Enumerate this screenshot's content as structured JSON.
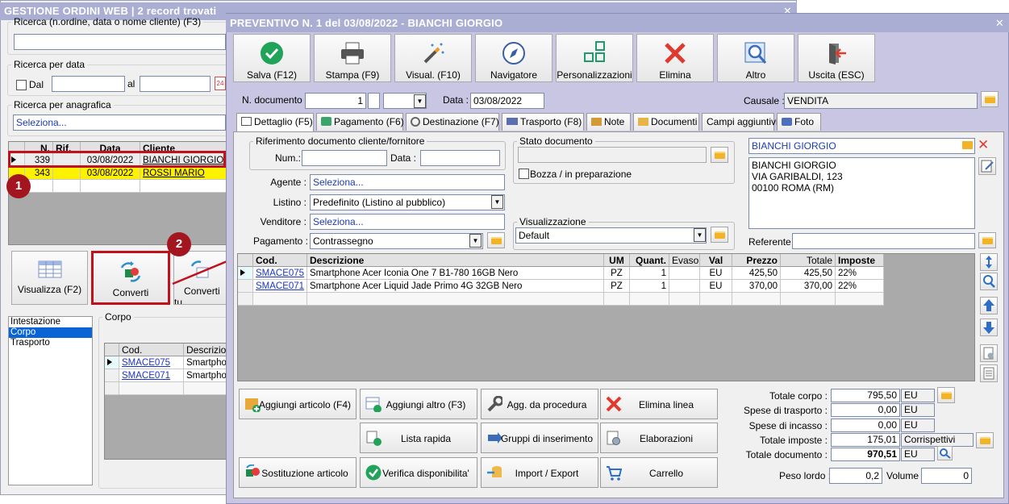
{
  "back": {
    "title": "GESTIONE ORDINI WEB | 2 record trovati",
    "search_legend": "Ricerca (n.ordine, data o nome cliente) (F3)",
    "date_legend": "Ricerca per data",
    "date_from_label": "Dal",
    "date_to_label": "al",
    "anag_legend": "Ricerca per anagrafica",
    "anag_value": "Seleziona...",
    "grid_headers": [
      "N.",
      "Rif.",
      "Data",
      "Cliente"
    ],
    "rows": [
      {
        "n": "339",
        "rif": "",
        "data": "03/08/2022",
        "cliente": "BIANCHI GIORGIO"
      },
      {
        "n": "343",
        "rif": "",
        "data": "03/08/2022",
        "cliente": "ROSSI MARIO"
      }
    ],
    "btn_visualizza": "Visualizza (F2)",
    "btn_converti": "Converti",
    "btn_converti_tutti": "Converti tu",
    "list_items": [
      "Intestazione",
      "Corpo",
      "Trasporto"
    ],
    "corpo_legend": "Corpo",
    "corpo_headers": [
      "Cod.",
      "Descrizion"
    ],
    "corpo_rows": [
      {
        "cod": "SMACE075",
        "desc": "Smartphon"
      },
      {
        "cod": "SMACE071",
        "desc": "Smartphon"
      }
    ],
    "step1": "1",
    "step2": "2"
  },
  "win": {
    "title": "PREVENTIVO N. 1 del 03/08/2022 - BIANCHI GIORGIO",
    "toolbar": [
      "Salva (F12)",
      "Stampa (F9)",
      "Visual. (F10)",
      "Navigatore",
      "Personalizzazioni",
      "Elimina",
      "Altro",
      "Uscita (ESC)"
    ],
    "ndoc_label": "N. documento :",
    "ndoc_value": "1",
    "data_label": "Data :",
    "data_value": "03/08/2022",
    "causale_label": "Causale :",
    "causale_value": "VENDITA",
    "tabs": [
      "Dettaglio (F5)",
      "Pagamento (F6)",
      "Destinazione (F7)",
      "Trasporto (F8)",
      "Note",
      "Documenti",
      "Campi aggiuntivi",
      "Foto"
    ],
    "rif_legend": "Riferimento documento cliente/fornitore",
    "num_label": "Num.:",
    "rdata_label": "Data :",
    "stato_legend": "Stato documento",
    "bozza_label": "Bozza / in preparazione",
    "agente_label": "Agente :",
    "agente_value": "Seleziona...",
    "listino_label": "Listino :",
    "listino_value": "Predefinito (Listino al pubblico)",
    "venditore_label": "Venditore :",
    "venditore_value": "Seleziona...",
    "pagamento_label": "Pagamento :",
    "pagamento_value": "Contrassegno",
    "visual_legend": "Visualizzazione",
    "visual_value": "Default",
    "cliente_name": "BIANCHI GIORGIO",
    "addr": [
      "BIANCHI GIORGIO",
      "VIA GARIBALDI, 123",
      "00100 ROMA (RM)"
    ],
    "referente_label": "Referente",
    "grid_headers": [
      "Cod.",
      "Descrizione",
      "UM",
      "Quant.",
      "Evaso",
      "Val",
      "Prezzo",
      "Totale",
      "Imposte"
    ],
    "rows": [
      {
        "cod": "SMACE075",
        "desc": "Smartphone Acer Iconia One 7 B1-780 16GB Nero",
        "um": "PZ",
        "q": "1",
        "evaso": "",
        "val": "EU",
        "prezzo": "425,50",
        "totale": "425,50",
        "imp": "22%"
      },
      {
        "cod": "SMACE071",
        "desc": "Smartphone Acer Liquid Jade Primo 4G 32GB Nero",
        "um": "PZ",
        "q": "1",
        "evaso": "",
        "val": "EU",
        "prezzo": "370,00",
        "totale": "370,00",
        "imp": "22%"
      }
    ],
    "actions": [
      "Aggiungi articolo (F4)",
      "Aggiungi altro (F3)",
      "Agg. da procedura",
      "Elimina linea",
      "Lista rapida",
      "Gruppi di inserimento",
      "Elaborazioni",
      "Sostituzione articolo",
      "Verifica disponibilita'",
      "Import / Export",
      "Carrello"
    ],
    "totals": [
      {
        "label": "Totale corpo :",
        "value": "795,50",
        "unit": "EU"
      },
      {
        "label": "Spese di trasporto :",
        "value": "0,00",
        "unit": "EU"
      },
      {
        "label": "Spese di incasso :",
        "value": "0,00",
        "unit": "EU"
      },
      {
        "label": "Totale imposte :",
        "value": "175,01",
        "unit": "Corrispettivi"
      },
      {
        "label": "Totale documento :",
        "value": "970,51",
        "unit": "EU"
      }
    ],
    "peso_label": "Peso lordo :",
    "peso_value": "0,2",
    "volume_label": "Volume :",
    "volume_value": "0"
  }
}
